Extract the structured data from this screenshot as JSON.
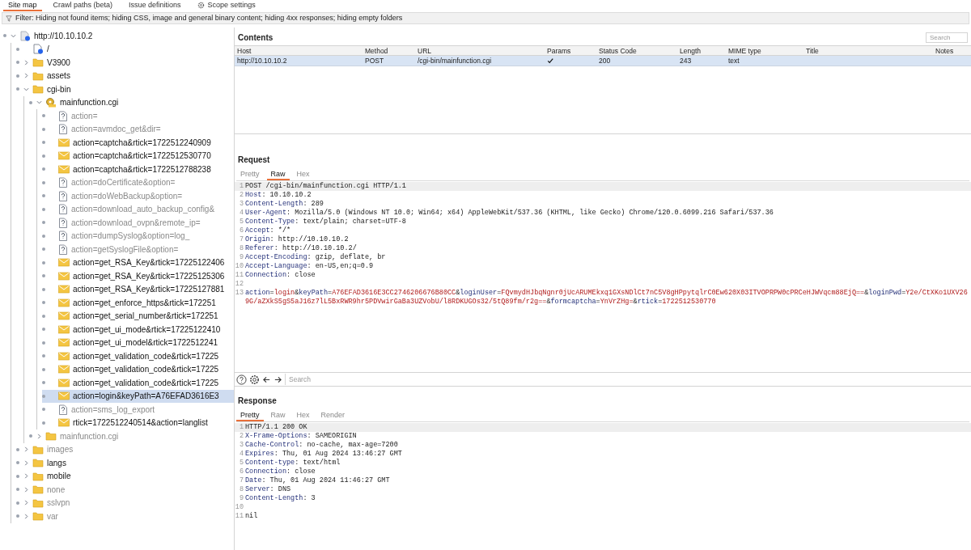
{
  "tabs": [
    {
      "label": "Site map",
      "selected": true,
      "kind": "text"
    },
    {
      "label": "Crawl paths (beta)",
      "selected": false,
      "kind": "text"
    },
    {
      "label": "Issue definitions",
      "selected": false,
      "kind": "text"
    },
    {
      "label": "Scope settings",
      "selected": false,
      "kind": "gear"
    }
  ],
  "filter": "Filter: Hiding not found items; hiding CSS, image and general binary content; hiding 4xx responses; hiding empty folders",
  "site_map_tree": [
    {
      "label": "http://10.10.10.2",
      "kind": "host",
      "expanded": true,
      "requested": true,
      "selected": false,
      "children": [
        {
          "label": "/",
          "kind": "page",
          "requested": true,
          "selected": false
        },
        {
          "label": "V3900",
          "kind": "folder",
          "expanded": false,
          "requested": true,
          "selected": false
        },
        {
          "label": "assets",
          "kind": "folder",
          "expanded": false,
          "requested": true,
          "selected": false
        },
        {
          "label": "cgi-bin",
          "kind": "folder",
          "expanded": true,
          "requested": true,
          "selected": false,
          "children": [
            {
              "label": "mainfunction.cgi",
              "kind": "script",
              "expanded": true,
              "requested": true,
              "selected": false,
              "children": [
                {
                  "label": "action=",
                  "kind": "unknown",
                  "requested": false,
                  "selected": false
                },
                {
                  "label": "action=avmdoc_get&dir=",
                  "kind": "unknown",
                  "requested": false,
                  "selected": false
                },
                {
                  "label": "action=captcha&rtick=1722512240909",
                  "kind": "request",
                  "requested": true,
                  "selected": false
                },
                {
                  "label": "action=captcha&rtick=1722512530770",
                  "kind": "request",
                  "requested": true,
                  "selected": false
                },
                {
                  "label": "action=captcha&rtick=1722512788238",
                  "kind": "request",
                  "requested": true,
                  "selected": false
                },
                {
                  "label": "action=doCertificate&option=",
                  "kind": "unknown",
                  "requested": false,
                  "selected": false
                },
                {
                  "label": "action=doWebBackup&option=",
                  "kind": "unknown",
                  "requested": false,
                  "selected": false
                },
                {
                  "label": "action=download_auto_backup_config&",
                  "kind": "unknown",
                  "requested": false,
                  "selected": false
                },
                {
                  "label": "action=download_ovpn&remote_ip=",
                  "kind": "unknown",
                  "requested": false,
                  "selected": false
                },
                {
                  "label": "action=dumpSyslog&option=log_",
                  "kind": "unknown",
                  "requested": false,
                  "selected": false
                },
                {
                  "label": "action=getSyslogFile&option=",
                  "kind": "unknown",
                  "requested": false,
                  "selected": false
                },
                {
                  "label": "action=get_RSA_Key&rtick=17225122406",
                  "kind": "request",
                  "requested": true,
                  "selected": false
                },
                {
                  "label": "action=get_RSA_Key&rtick=17225125306",
                  "kind": "request",
                  "requested": true,
                  "selected": false
                },
                {
                  "label": "action=get_RSA_Key&rtick=17225127881",
                  "kind": "request",
                  "requested": true,
                  "selected": false
                },
                {
                  "label": "action=get_enforce_https&rtick=172251",
                  "kind": "request",
                  "requested": true,
                  "selected": false
                },
                {
                  "label": "action=get_serial_number&rtick=172251",
                  "kind": "request",
                  "requested": true,
                  "selected": false
                },
                {
                  "label": "action=get_ui_mode&rtick=17225122410",
                  "kind": "request",
                  "requested": true,
                  "selected": false
                },
                {
                  "label": "action=get_ui_model&rtick=1722512241",
                  "kind": "request",
                  "requested": true,
                  "selected": false
                },
                {
                  "label": "action=get_validation_code&rtick=17225",
                  "kind": "request",
                  "requested": true,
                  "selected": false
                },
                {
                  "label": "action=get_validation_code&rtick=17225",
                  "kind": "request",
                  "requested": true,
                  "selected": false
                },
                {
                  "label": "action=get_validation_code&rtick=17225",
                  "kind": "request",
                  "requested": true,
                  "selected": false
                },
                {
                  "label": "action=login&keyPath=A76EFAD3616E3",
                  "kind": "request",
                  "requested": true,
                  "selected": true
                },
                {
                  "label": "action=sms_log_export",
                  "kind": "unknown",
                  "requested": false,
                  "selected": false
                },
                {
                  "label": "rtick=1722512240514&action=langlist",
                  "kind": "request",
                  "requested": true,
                  "selected": false
                }
              ]
            },
            {
              "label": "mainfunction.cgi",
              "kind": "folder",
              "expanded": false,
              "requested": false,
              "selected": false
            }
          ]
        },
        {
          "label": "images",
          "kind": "folder",
          "expanded": false,
          "requested": false,
          "selected": false
        },
        {
          "label": "langs",
          "kind": "folder",
          "expanded": false,
          "requested": true,
          "selected": false
        },
        {
          "label": "mobile",
          "kind": "folder",
          "expanded": false,
          "requested": true,
          "selected": false
        },
        {
          "label": "none",
          "kind": "folder",
          "expanded": false,
          "requested": false,
          "selected": false
        },
        {
          "label": "sslvpn",
          "kind": "folder",
          "expanded": false,
          "requested": false,
          "selected": false
        },
        {
          "label": "var",
          "kind": "folder",
          "expanded": false,
          "requested": false,
          "selected": false
        }
      ]
    }
  ],
  "contents": {
    "title": "Contents",
    "search": {
      "placeholder": "Search"
    },
    "columns": [
      "Host",
      "Method",
      "URL",
      "Params",
      "Status Code",
      "Length",
      "MIME type",
      "Title",
      "Notes"
    ],
    "rows": [
      {
        "selected": true,
        "host": "http://10.10.10.2",
        "method": "POST",
        "url": "/cgi-bin/mainfunction.cgi",
        "params": true,
        "status_code": "200",
        "length": "243",
        "mime_type": "text"
      }
    ]
  },
  "request": {
    "title": "Request",
    "tabs": [
      {
        "label": "Pretty",
        "selected": false
      },
      {
        "label": "Raw",
        "selected": true
      },
      {
        "label": "Hex",
        "selected": false
      }
    ],
    "lines": [
      {
        "number": "1",
        "current": true,
        "segments": [
          {
            "kind": "plain",
            "text": "POST /cgi-bin/mainfunction.cgi HTTP/1.1"
          }
        ]
      },
      {
        "number": "2",
        "current": false,
        "segments": [
          {
            "kind": "key",
            "text": "Host"
          },
          {
            "kind": "plain",
            "text": ": 10.10.10.2"
          }
        ]
      },
      {
        "number": "3",
        "current": false,
        "segments": [
          {
            "kind": "key",
            "text": "Content-Length"
          },
          {
            "kind": "plain",
            "text": ": 289"
          }
        ]
      },
      {
        "number": "4",
        "current": false,
        "segments": [
          {
            "kind": "key",
            "text": "User-Agent"
          },
          {
            "kind": "plain",
            "text": ": Mozilla/5.0 (Windows NT 10.0; Win64; x64) AppleWebKit/537.36 (KHTML, like Gecko) Chrome/120.0.6099.216 Safari/537.36"
          }
        ]
      },
      {
        "number": "5",
        "current": false,
        "segments": [
          {
            "kind": "key",
            "text": "Content-Type"
          },
          {
            "kind": "plain",
            "text": ": text/plain; charset=UTF-8"
          }
        ]
      },
      {
        "number": "6",
        "current": false,
        "segments": [
          {
            "kind": "key",
            "text": "Accept"
          },
          {
            "kind": "plain",
            "text": ": */*"
          }
        ]
      },
      {
        "number": "7",
        "current": false,
        "segments": [
          {
            "kind": "key",
            "text": "Origin"
          },
          {
            "kind": "plain",
            "text": ": http://10.10.10.2"
          }
        ]
      },
      {
        "number": "8",
        "current": false,
        "segments": [
          {
            "kind": "key",
            "text": "Referer"
          },
          {
            "kind": "plain",
            "text": ": http://10.10.10.2/"
          }
        ]
      },
      {
        "number": "9",
        "current": false,
        "segments": [
          {
            "kind": "key",
            "text": "Accept-Encoding"
          },
          {
            "kind": "plain",
            "text": ": gzip, deflate, br"
          }
        ]
      },
      {
        "number": "10",
        "current": false,
        "segments": [
          {
            "kind": "key",
            "text": "Accept-Language"
          },
          {
            "kind": "plain",
            "text": ": en-US,en;q=0.9"
          }
        ]
      },
      {
        "number": "11",
        "current": false,
        "segments": [
          {
            "kind": "key",
            "text": "Connection"
          },
          {
            "kind": "plain",
            "text": ": close"
          }
        ]
      },
      {
        "number": "12",
        "current": false
      },
      {
        "number": "13",
        "current": false,
        "segments": [
          {
            "kind": "key",
            "text": "action"
          },
          {
            "kind": "plain",
            "text": "="
          },
          {
            "kind": "val",
            "text": "login"
          },
          {
            "kind": "plain",
            "text": "&"
          },
          {
            "kind": "key",
            "text": "keyPath"
          },
          {
            "kind": "plain",
            "text": "="
          },
          {
            "kind": "val",
            "text": "A76EFAD3616E3CC2746206676B80CC"
          },
          {
            "kind": "plain",
            "text": "&"
          },
          {
            "kind": "key",
            "text": "loginUser"
          },
          {
            "kind": "plain",
            "text": "="
          },
          {
            "kind": "val",
            "text": "FQvmydHJbqNgnr0jUcARUMEkxq1GXsNDlCt7nC5V8gHPpytqlrC0Ew620X03ITVOPRPW0cPRCeHJWVqcm88EjQ=="
          },
          {
            "kind": "plain",
            "text": "&"
          },
          {
            "kind": "key",
            "text": "loginPwd"
          },
          {
            "kind": "plain",
            "text": "="
          },
          {
            "kind": "val",
            "text": "Y2e/CtXKo1UXV269G/aZXkS5gS5aJ16z7lL5BxRWR9hr5PDVwirGaBa3UZVobU/l8RDKUGOs32/5tQ89fm/r2g=="
          },
          {
            "kind": "plain",
            "text": "&"
          },
          {
            "kind": "key",
            "text": "formcaptcha"
          },
          {
            "kind": "plain",
            "text": "="
          },
          {
            "kind": "val",
            "text": "YnVrZHg="
          },
          {
            "kind": "plain",
            "text": "&"
          },
          {
            "kind": "key",
            "text": "rtick"
          },
          {
            "kind": "plain",
            "text": "="
          },
          {
            "kind": "val",
            "text": "1722512530770"
          }
        ]
      }
    ]
  },
  "search_bar": {
    "placeholder": "Search"
  },
  "response": {
    "title": "Response",
    "tabs": [
      {
        "label": "Pretty",
        "selected": true
      },
      {
        "label": "Raw",
        "selected": false
      },
      {
        "label": "Hex",
        "selected": false
      },
      {
        "label": "Render",
        "selected": false
      }
    ],
    "lines": [
      {
        "number": "1",
        "current": true,
        "segments": [
          {
            "kind": "plain",
            "text": "HTTP/1.1 200 OK"
          }
        ]
      },
      {
        "number": "2",
        "current": false,
        "segments": [
          {
            "kind": "key",
            "text": "X-Frame-Options"
          },
          {
            "kind": "plain",
            "text": ": SAMEORIGIN"
          }
        ]
      },
      {
        "number": "3",
        "current": false,
        "segments": [
          {
            "kind": "key",
            "text": "Cache-Control"
          },
          {
            "kind": "plain",
            "text": ": no-cache, max-age=7200"
          }
        ]
      },
      {
        "number": "4",
        "current": false,
        "segments": [
          {
            "kind": "key",
            "text": "Expires"
          },
          {
            "kind": "plain",
            "text": ": Thu, 01 Aug 2024 13:46:27 GMT"
          }
        ]
      },
      {
        "number": "5",
        "current": false,
        "segments": [
          {
            "kind": "key",
            "text": "Content-type"
          },
          {
            "kind": "plain",
            "text": ": text/html"
          }
        ]
      },
      {
        "number": "6",
        "current": false,
        "segments": [
          {
            "kind": "key",
            "text": "Connection"
          },
          {
            "kind": "plain",
            "text": ": close"
          }
        ]
      },
      {
        "number": "7",
        "current": false,
        "segments": [
          {
            "kind": "key",
            "text": "Date"
          },
          {
            "kind": "plain",
            "text": ": Thu, 01 Aug 2024 11:46:27 GMT"
          }
        ]
      },
      {
        "number": "8",
        "current": false,
        "segments": [
          {
            "kind": "key",
            "text": "Server"
          },
          {
            "kind": "plain",
            "text": ": DNS"
          }
        ]
      },
      {
        "number": "9",
        "current": false,
        "segments": [
          {
            "kind": "key",
            "text": "Content-Length"
          },
          {
            "kind": "plain",
            "text": ": 3"
          }
        ]
      },
      {
        "number": "10",
        "current": false
      },
      {
        "number": "11",
        "current": false,
        "segments": [
          {
            "kind": "plain",
            "text": "nil"
          }
        ]
      }
    ]
  }
}
